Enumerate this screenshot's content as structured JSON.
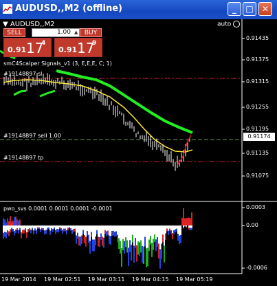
{
  "window": {
    "title": "AUDUSD,,M2 (offline)",
    "min_glyph": "_",
    "max_glyph": "□",
    "close_glyph": "✕"
  },
  "chart": {
    "symbol_tab": "AUDUSD,,M2",
    "auto_label": "auto",
    "indicator_label": "smC4Scalper Signals_v1 (3, E,E,E, C; 1)",
    "order_label_top": "#19148897 sl",
    "order_label_sell": "#19148897 sell 1.00",
    "order_label_tp": "#19148897 tp",
    "subwindow_label": "pwo_svs 0.0001 0.0001 0.0001 -0.0001",
    "current_price": "0.91174",
    "price_axis": [
      "0.91435",
      "0.91375",
      "0.91315",
      "0.91255",
      "0.91195",
      "0.91135",
      "0.91075"
    ],
    "sub_axis": [
      "0.0003",
      "0.00",
      "-0.0006"
    ],
    "time_axis": [
      "19 Mar 2014",
      "19 Mar 02:51",
      "19 Mar 03:11",
      "19 Mar 04:15",
      "19 Mar 05:19"
    ],
    "colors": {
      "background": "#000000",
      "ma_fast": "#ffe838",
      "ma_slow": "#22ee22",
      "bars": "#ffffff",
      "level_line": "#cc2222",
      "hist_pos": "#ffffff",
      "hist_neg": "#2244dd"
    }
  },
  "trade_panel": {
    "sell_label": "SELL",
    "buy_label": "BUY",
    "lot_value": "1.00",
    "sell_prefix": "0.91",
    "sell_big": "17",
    "sell_sup": "4",
    "buy_prefix": "0.91",
    "buy_big": "17",
    "buy_sup": "9"
  }
}
